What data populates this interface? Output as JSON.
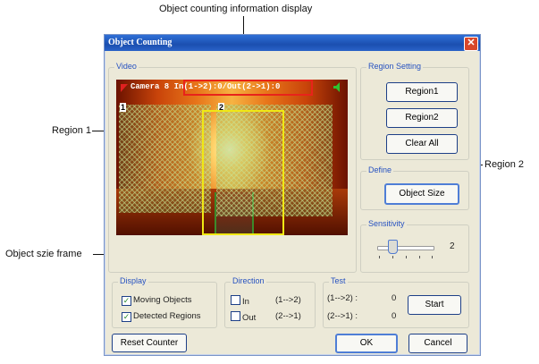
{
  "annotations": {
    "top": "Object counting information display",
    "region1": "Region 1",
    "region2": "Region 2",
    "size_frame": "Object szie frame"
  },
  "dialog": {
    "title": "Object Counting",
    "close_glyph": "✕"
  },
  "video": {
    "group_label": "Video",
    "overlay_text": "Camera 8 In(1->2):0/Out(2->1):0",
    "region1_num": "1",
    "region2_num": "2"
  },
  "region_setting": {
    "group_label": "Region Setting",
    "region1_btn": "Region1",
    "region2_btn": "Region2",
    "clear_btn": "Clear All"
  },
  "define": {
    "group_label": "Define",
    "object_size_btn": "Object Size"
  },
  "sensitivity": {
    "group_label": "Sensitivity",
    "value": "2",
    "level": 2
  },
  "display": {
    "group_label": "Display",
    "moving_objects": "Moving Objects",
    "detected_regions": "Detected Regions",
    "check_glyph": "✓"
  },
  "direction": {
    "group_label": "Direction",
    "in_label": "In",
    "in_dir": "(1-->2)",
    "out_label": "Out",
    "out_dir": "(2-->1)"
  },
  "test": {
    "group_label": "Test",
    "in_dir": "(1-->2) :",
    "in_val": "0",
    "out_dir": "(2-->1) :",
    "out_val": "0",
    "start_btn": "Start"
  },
  "footer": {
    "reset_btn": "Reset Counter",
    "ok_btn": "OK",
    "cancel_btn": "Cancel"
  },
  "colors": {
    "title_bar": "#1b4fb0",
    "region_fill": "#8cc060",
    "size_frame": "#f0e814",
    "info_box": "#e8231b"
  }
}
